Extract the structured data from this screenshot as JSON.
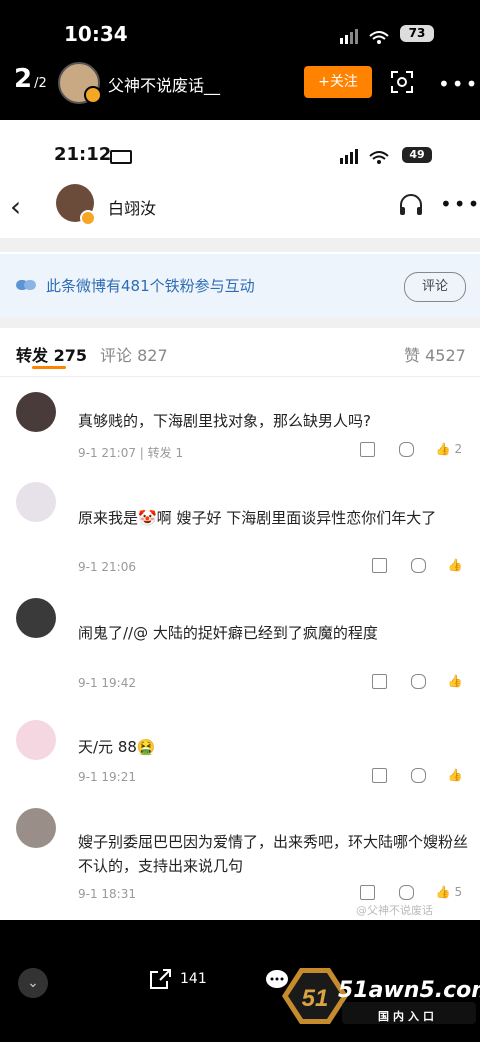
{
  "outer": {
    "time": "10:34",
    "battery": "73",
    "pager_current": "2",
    "pager_total": "/2",
    "author": "父神不说废话__",
    "follow_label": "+关注"
  },
  "inner": {
    "time": "21:12",
    "battery": "49",
    "author": "白翊汝",
    "banner_text": "此条微博有481个铁粉参与互动",
    "comment_button": "评论",
    "tab_repost": "转发 275",
    "tab_comment": "评论 827",
    "tab_like": "赞 4527"
  },
  "reposts": [
    {
      "text": "真够贱的，下海剧里找对象，那么缺男人吗?",
      "meta": "9-1 21:07 | 转发 1",
      "likes": "2",
      "avatar_color": "#4a3b3b"
    },
    {
      "text": "原来我是🤡啊 嫂子好 下海剧里面谈异性恋你们年大了",
      "meta": "9-1 21:06",
      "likes": "",
      "avatar_color": "#e7e2ea"
    },
    {
      "text": "闹鬼了//@ 大陆的捉奸癖已经到了疯魔的程度",
      "meta": "9-1 19:42",
      "likes": "",
      "avatar_color": "#3a3a3a"
    },
    {
      "text": "天/元 88🤮",
      "meta": "9-1 19:21",
      "likes": "",
      "avatar_color": "#f4d7e0"
    },
    {
      "text": "嫂子别委屈巴巴因为爱情了，出来秀吧，环大陆哪个嫂粉丝不认的，支持出来说几句",
      "meta": "9-1 18:31",
      "likes": "5",
      "avatar_color": "#9a8f88"
    }
  ],
  "watermark": "@父神不说废话",
  "bottom": {
    "share_count": "141",
    "logo_main": "51awn5.com",
    "logo_sub": "国内入口",
    "logo_badge": "51"
  }
}
